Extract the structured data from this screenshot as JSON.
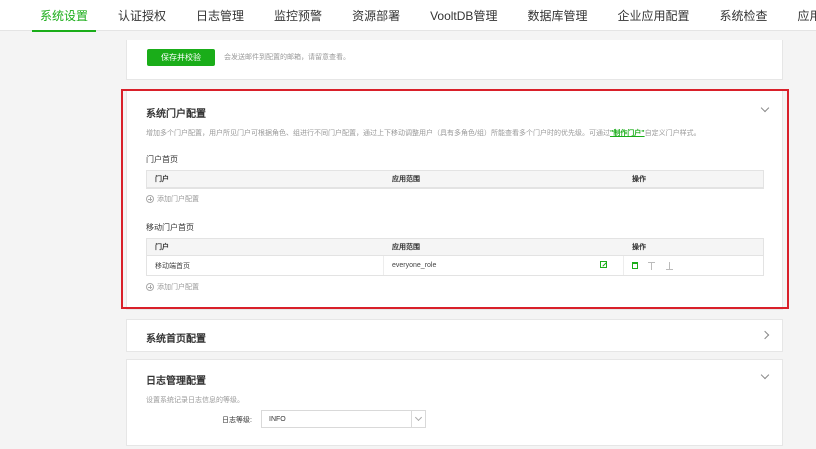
{
  "nav": {
    "tabs": [
      {
        "label": "系统设置",
        "active": true
      },
      {
        "label": "认证授权"
      },
      {
        "label": "日志管理"
      },
      {
        "label": "监控预警"
      },
      {
        "label": "资源部署"
      },
      {
        "label": "VooltDB管理"
      },
      {
        "label": "数据库管理"
      },
      {
        "label": "企业应用配置"
      },
      {
        "label": "系统检查"
      },
      {
        "label": "应用管理"
      }
    ]
  },
  "mail": {
    "save_button": "保存并校验",
    "hint": "会发送邮件到配置的邮箱，请留意查看。"
  },
  "portal": {
    "title": "系统门户配置",
    "description_prefix": "增加多个门户配置，用户所见门户可根据角色、组进行不同门户配置，通过上下移动调整用户（具有多角色/组）所能查看多个门户时的优先级。可通过",
    "description_link": "\"制作门户\"",
    "description_suffix": "自定义门户样式。",
    "home": {
      "label": "门户首页",
      "columns": [
        "门户",
        "应用范围",
        "操作"
      ],
      "add_label": "添加门户配置"
    },
    "mobile": {
      "label": "移动门户首页",
      "columns": [
        "门户",
        "应用范围",
        "操作"
      ],
      "rows": [
        {
          "portal": "移动端首页",
          "scope": "everyone_role"
        }
      ],
      "add_label": "添加门户配置"
    }
  },
  "home_config": {
    "title": "系统首页配置"
  },
  "log": {
    "title": "日志管理配置",
    "description": "设置系统记录日志信息的等级。",
    "level_label": "日志等级:",
    "level_value": "INFO"
  },
  "colors": {
    "accent": "#1aad19",
    "highlight": "#d9202a"
  }
}
